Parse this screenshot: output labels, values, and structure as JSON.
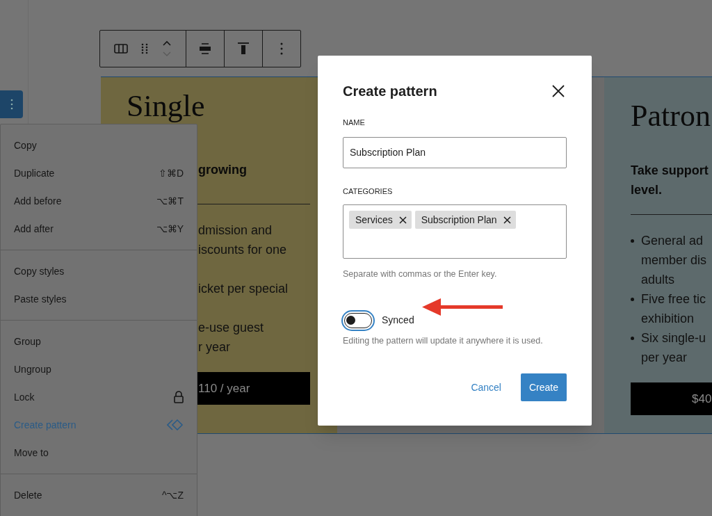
{
  "block_toolbar": {
    "buttons": [
      {
        "kind": "columns"
      },
      {
        "kind": "drag"
      },
      {
        "kind": "move"
      },
      {
        "kind": "align"
      },
      {
        "kind": "valign"
      },
      {
        "kind": "more"
      }
    ]
  },
  "cards": [
    {
      "kind": "single",
      "heading": "Single",
      "lead": [
        "growing"
      ],
      "lines": [
        {
          "text": "dmission and",
          "kind": "start"
        },
        {
          "text": "iscounts for one",
          "kind": "wrap"
        },
        {
          "text": "icket per special",
          "kind": "start"
        },
        {
          "text": "e-use guest",
          "kind": "start"
        },
        {
          "text": "r year",
          "kind": "wrap"
        }
      ],
      "price": "110 / year"
    },
    {
      "kind": "patron",
      "heading": "Patron",
      "lead": [
        "Take support",
        "level."
      ],
      "lines": [
        {
          "text": "General ad",
          "kind": "start"
        },
        {
          "text": "member dis",
          "kind": "wrap"
        },
        {
          "text": "adults",
          "kind": "wrap"
        },
        {
          "text": "Five free tic",
          "kind": "start"
        },
        {
          "text": "exhibition",
          "kind": "wrap"
        },
        {
          "text": "Six single-u",
          "kind": "start"
        },
        {
          "text": "per year",
          "kind": "wrap"
        }
      ],
      "price": "$40"
    }
  ],
  "context_menu": {
    "sections": [
      [
        {
          "label": "Copy",
          "selected": false
        },
        {
          "label": "Duplicate",
          "shortcut": "⇧⌘D",
          "selected": false
        },
        {
          "label": "Add before",
          "shortcut": "⌥⌘T",
          "selected": false
        },
        {
          "label": "Add after",
          "shortcut": "⌥⌘Y",
          "selected": false
        }
      ],
      [
        {
          "label": "Copy styles",
          "selected": false
        },
        {
          "label": "Paste styles",
          "selected": false
        }
      ],
      [
        {
          "label": "Group",
          "selected": false
        },
        {
          "label": "Ungroup",
          "selected": false
        },
        {
          "label": "Lock",
          "kind": "lock",
          "selected": false
        },
        {
          "label": "Create pattern",
          "kind": "pattern",
          "selected": true
        },
        {
          "label": "Move to",
          "selected": false
        }
      ],
      [
        {
          "label": "Delete",
          "shortcut": "^⌥Z",
          "selected": false
        }
      ]
    ]
  },
  "dialog": {
    "title": "Create pattern",
    "name_label": "NAME",
    "name_value": "Subscription Plan",
    "categories_label": "CATEGORIES",
    "categories": [
      "Services",
      "Subscription Plan"
    ],
    "categories_help": "Separate with commas or the Enter key.",
    "synced": {
      "label": "Synced",
      "on": false,
      "help": "Editing the pattern will update it anywhere it is used."
    },
    "buttons": [
      {
        "label": "Cancel",
        "kind": "secondary"
      },
      {
        "label": "Create",
        "kind": "primary"
      }
    ]
  }
}
